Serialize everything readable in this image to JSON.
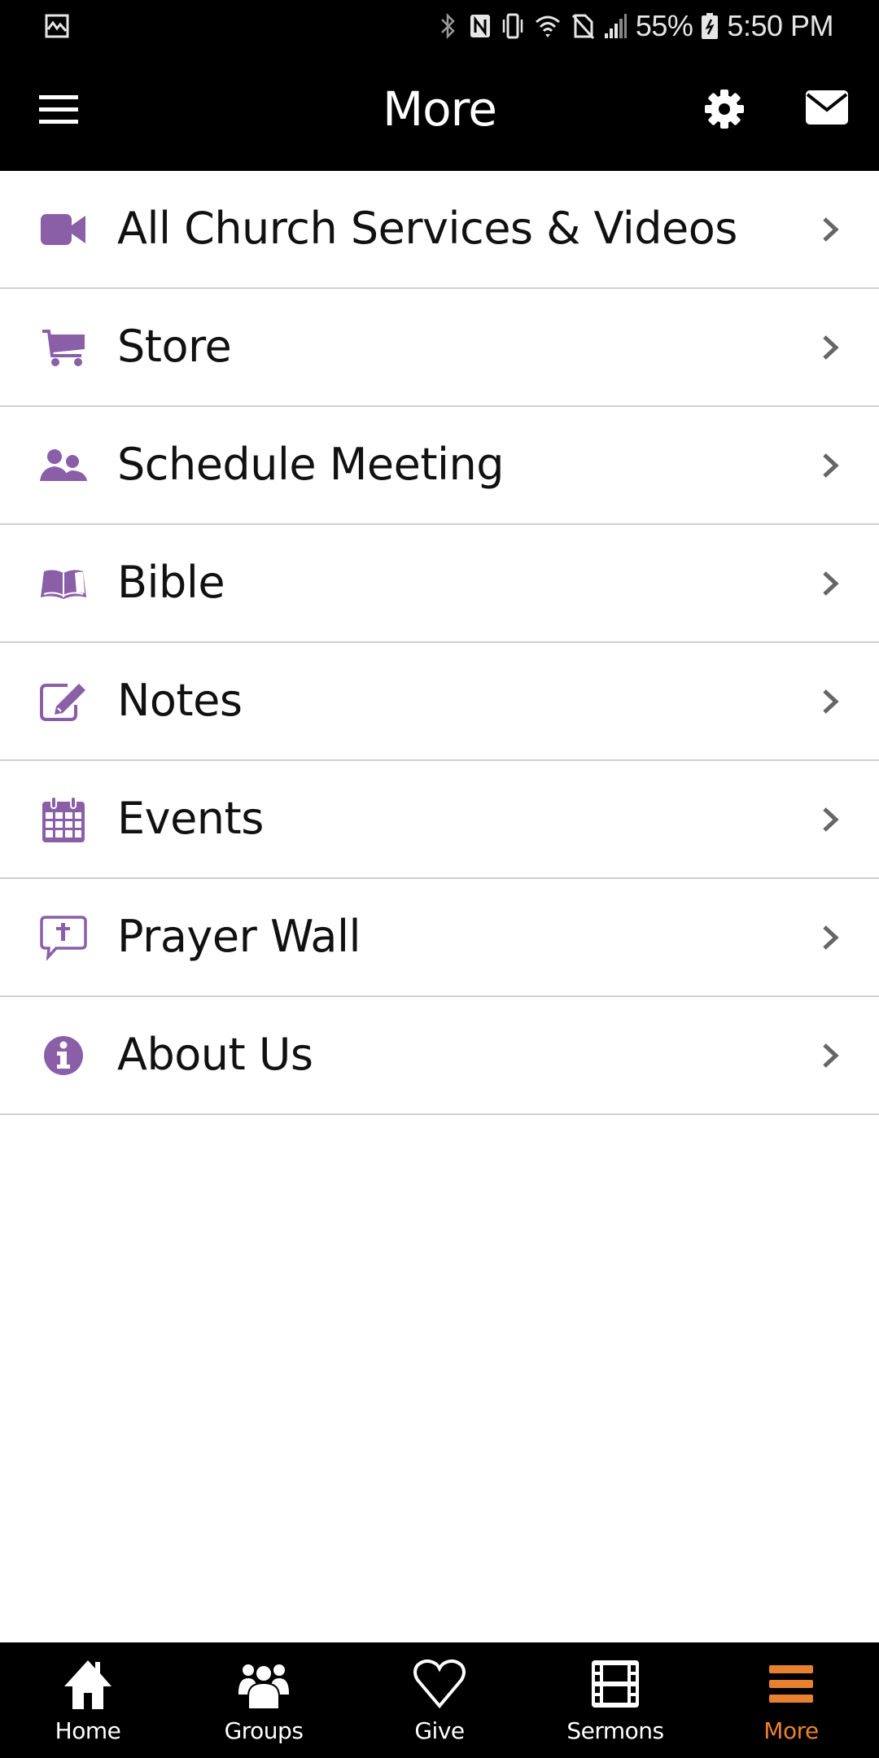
{
  "status_bar": {
    "battery": "55%",
    "time": "5:50 PM",
    "icons": [
      "image-notification-icon",
      "bluetooth-icon",
      "nfc-icon",
      "vibrate-icon",
      "wifi-icon",
      "no-sim-icon",
      "signal-icon",
      "battery-charging-icon"
    ]
  },
  "header": {
    "title": "More",
    "menu_icon": "hamburger-icon",
    "settings_icon": "gear-icon",
    "messages_icon": "envelope-icon"
  },
  "menu": {
    "items": [
      {
        "label": "All Church Services & Videos",
        "icon": "video-camera-icon"
      },
      {
        "label": "Store",
        "icon": "shopping-cart-icon"
      },
      {
        "label": "Schedule Meeting",
        "icon": "users-icon"
      },
      {
        "label": "Bible",
        "icon": "open-book-icon"
      },
      {
        "label": "Notes",
        "icon": "edit-note-icon"
      },
      {
        "label": "Events",
        "icon": "calendar-icon"
      },
      {
        "label": "Prayer Wall",
        "icon": "prayer-bubble-icon"
      },
      {
        "label": "About Us",
        "icon": "info-icon"
      }
    ]
  },
  "tab_bar": {
    "active": "More",
    "tabs": [
      {
        "label": "Home",
        "icon": "home-icon"
      },
      {
        "label": "Groups",
        "icon": "group-icon"
      },
      {
        "label": "Give",
        "icon": "heart-icon"
      },
      {
        "label": "Sermons",
        "icon": "film-icon"
      },
      {
        "label": "More",
        "icon": "hamburger-icon"
      }
    ]
  },
  "colors": {
    "accent_purple": "#8a5fa8",
    "active_tab_orange": "#e8812f",
    "header_background": "#000000",
    "chevron_gray": "#666666",
    "divider": "#d0d0d0"
  }
}
